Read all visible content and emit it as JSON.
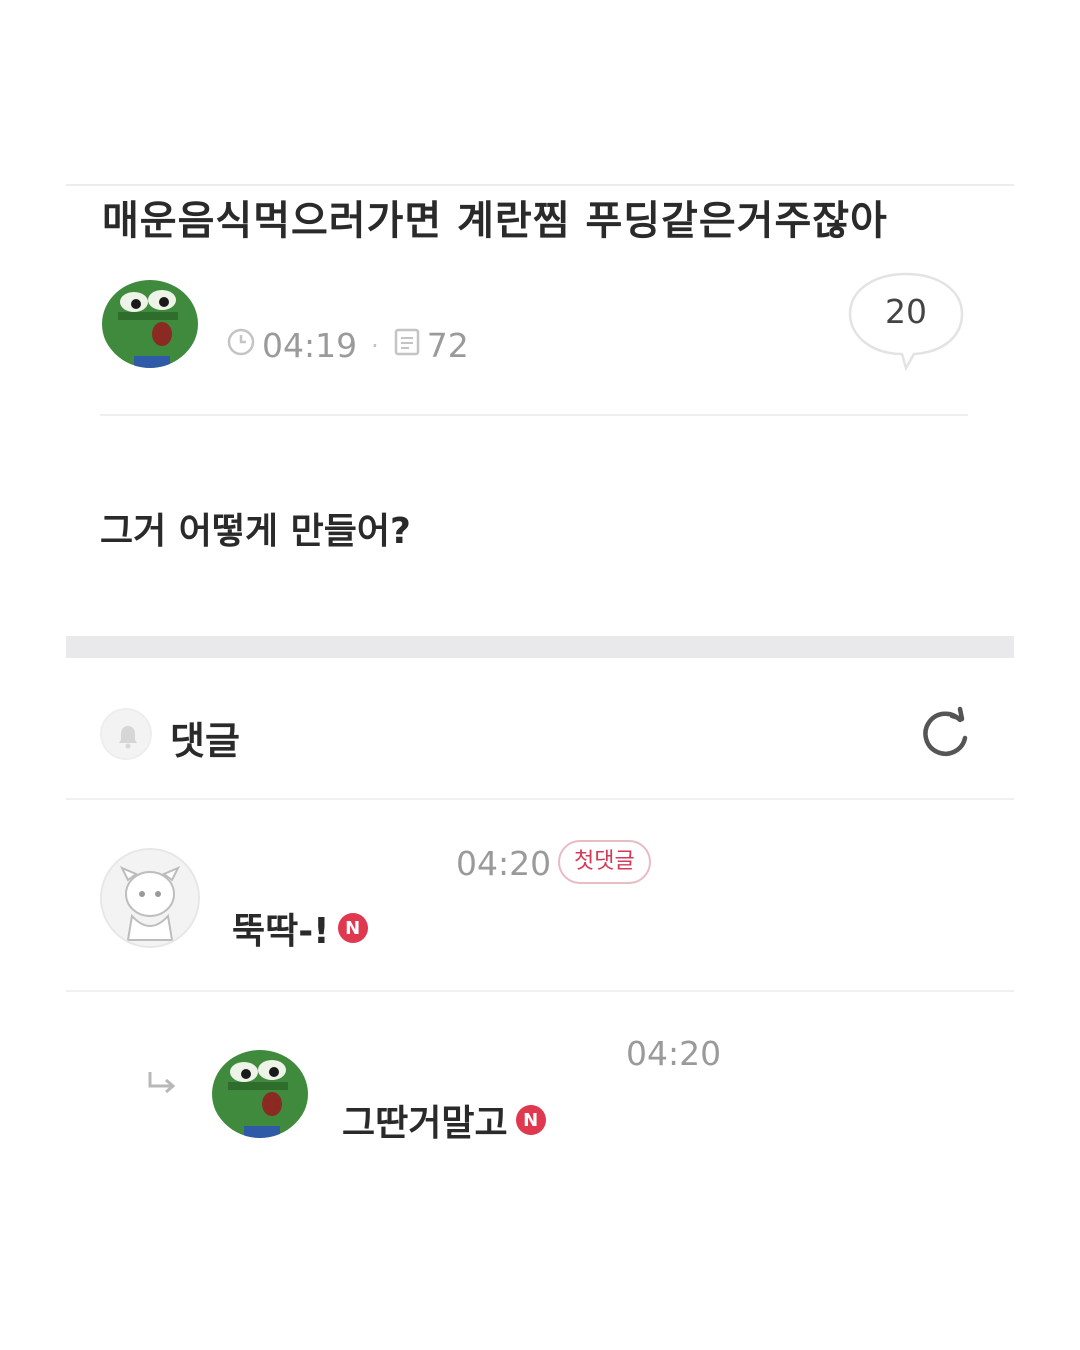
{
  "post": {
    "title": "매운음식먹으러가면 계란찜 푸딩같은거주잖아",
    "time": "04:19",
    "views": "72",
    "comment_count": "20",
    "body": "그거 어떻게 만들어?"
  },
  "comments_section": {
    "label": "댓글"
  },
  "comments": [
    {
      "time": "04:20",
      "badge": "첫댓글",
      "text": "뚝딱-!",
      "new_badge": "N"
    },
    {
      "time": "04:20",
      "text": "그딴거말고",
      "new_badge": "N"
    }
  ],
  "icons": {
    "clock": "clock-icon",
    "views": "document-icon",
    "bell": "bell-icon",
    "refresh": "refresh-icon",
    "reply": "reply-arrow-icon"
  },
  "colors": {
    "accent_red": "#e0384f",
    "meta_gray": "#9a9a9a",
    "frog_green": "#3f8a3c"
  }
}
